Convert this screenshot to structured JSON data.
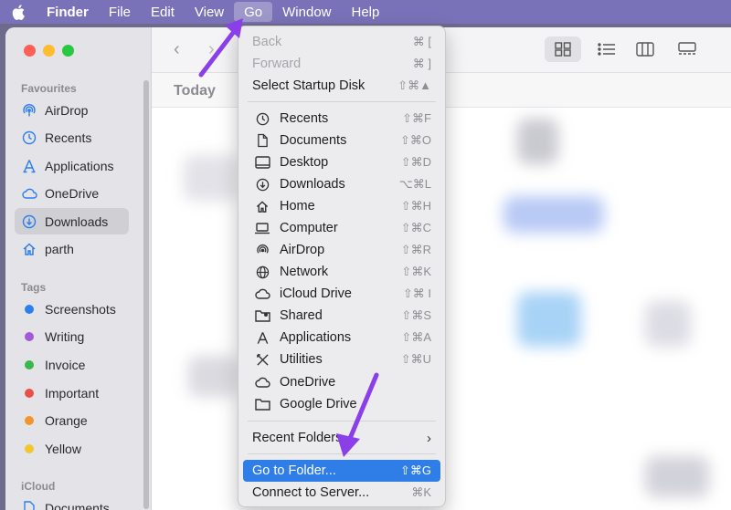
{
  "menubar": {
    "items": [
      {
        "label": "Finder"
      },
      {
        "label": "File"
      },
      {
        "label": "Edit"
      },
      {
        "label": "View"
      },
      {
        "label": "Go"
      },
      {
        "label": "Window"
      },
      {
        "label": "Help"
      }
    ]
  },
  "sidebar": {
    "favourites_title": "Favourites",
    "favourites": [
      {
        "label": "AirDrop",
        "icon": "airdrop-icon"
      },
      {
        "label": "Recents",
        "icon": "clock-icon"
      },
      {
        "label": "Applications",
        "icon": "applications-icon"
      },
      {
        "label": "OneDrive",
        "icon": "cloud-icon"
      },
      {
        "label": "Downloads",
        "icon": "download-icon"
      },
      {
        "label": "parth",
        "icon": "home-icon"
      }
    ],
    "tags_title": "Tags",
    "tags": [
      {
        "label": "Screenshots",
        "color": "#2d7ff0"
      },
      {
        "label": "Writing",
        "color": "#a25ad6"
      },
      {
        "label": "Invoice",
        "color": "#3cb84a"
      },
      {
        "label": "Important",
        "color": "#e8504a"
      },
      {
        "label": "Orange",
        "color": "#f2952e"
      },
      {
        "label": "Yellow",
        "color": "#f3c72f"
      }
    ],
    "icloud_title": "iCloud",
    "icloud_items": [
      {
        "label": "Documents"
      }
    ]
  },
  "main": {
    "section_title": "Today"
  },
  "go_menu": {
    "nav": [
      {
        "label": "Back",
        "shortcut": "⌘ [",
        "disabled": true
      },
      {
        "label": "Forward",
        "shortcut": "⌘ ]",
        "disabled": true
      },
      {
        "label": "Select Startup Disk",
        "shortcut": "⇧⌘▲"
      }
    ],
    "places": [
      {
        "label": "Recents",
        "shortcut": "⇧⌘F",
        "icon": "clock-icon"
      },
      {
        "label": "Documents",
        "shortcut": "⇧⌘O",
        "icon": "document-icon"
      },
      {
        "label": "Desktop",
        "shortcut": "⇧⌘D",
        "icon": "desktop-icon"
      },
      {
        "label": "Downloads",
        "shortcut": "⌥⌘L",
        "icon": "download-icon"
      },
      {
        "label": "Home",
        "shortcut": "⇧⌘H",
        "icon": "home-icon"
      },
      {
        "label": "Computer",
        "shortcut": "⇧⌘C",
        "icon": "laptop-icon"
      },
      {
        "label": "AirDrop",
        "shortcut": "⇧⌘R",
        "icon": "airdrop-icon"
      },
      {
        "label": "Network",
        "shortcut": "⇧⌘K",
        "icon": "globe-icon"
      },
      {
        "label": "iCloud Drive",
        "shortcut": "⇧⌘ I",
        "icon": "cloud-icon"
      },
      {
        "label": "Shared",
        "shortcut": "⇧⌘S",
        "icon": "shared-folder-icon"
      },
      {
        "label": "Applications",
        "shortcut": "⇧⌘A",
        "icon": "applications-icon"
      },
      {
        "label": "Utilities",
        "shortcut": "⇧⌘U",
        "icon": "utilities-icon"
      },
      {
        "label": "OneDrive",
        "shortcut": "",
        "icon": "cloud-icon"
      },
      {
        "label": "Google Drive",
        "shortcut": "",
        "icon": "folder-icon"
      }
    ],
    "recent_folders": "Recent Folders",
    "go_to_folder": {
      "label": "Go to Folder...",
      "shortcut": "⇧⌘G"
    },
    "connect": {
      "label": "Connect to Server...",
      "shortcut": "⌘K"
    }
  },
  "colors": {
    "accent": "#2f7de6",
    "annotation_arrow": "#8a3fe8",
    "menubar": "#7a72b8"
  }
}
